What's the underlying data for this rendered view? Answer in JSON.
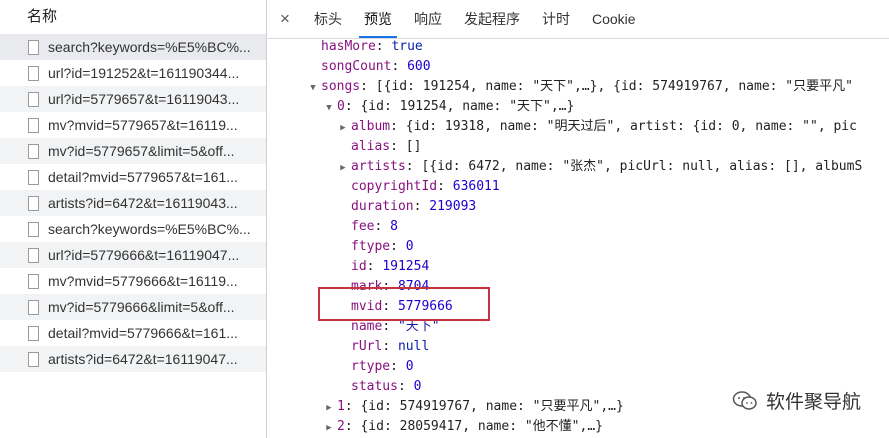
{
  "left_panel": {
    "header": "名称",
    "requests": [
      "search?keywords=%E5%BC%...",
      "url?id=191252&t=161190344...",
      "url?id=5779657&t=16119043...",
      "mv?mvid=5779657&t=16119...",
      "mv?id=5779657&limit=5&off...",
      "detail?mvid=5779657&t=161...",
      "artists?id=6472&t=16119043...",
      "search?keywords=%E5%BC%...",
      "url?id=5779666&t=16119047...",
      "mv?mvid=5779666&t=16119...",
      "mv?id=5779666&limit=5&off...",
      "detail?mvid=5779666&t=161...",
      "artists?id=6472&t=16119047..."
    ]
  },
  "tabs": {
    "close": "×",
    "items": [
      "标头",
      "预览",
      "响应",
      "发起程序",
      "计时",
      "Cookie"
    ],
    "active": "预览"
  },
  "tree": {
    "l1_key": "hasMore",
    "l1_val": "true",
    "l2_key": "songCount",
    "l2_val": "600",
    "l3_key": "songs",
    "l3_val": "[{id: 191254, name: \"天下\",…}, {id: 574919767, name: \"只要平凡\"",
    "l4_key": "0",
    "l4_val": "{id: 191254, name: \"天下\",…}",
    "l5_key": "album",
    "l5_val": "{id: 19318, name: \"明天过后\", artist: {id: 0, name: \"\", pic",
    "l6_key": "alias",
    "l6_val": "[]",
    "l7_key": "artists",
    "l7_val": "[{id: 6472, name: \"张杰\", picUrl: null, alias: [], albumS",
    "l8_key": "copyrightId",
    "l8_val": "636011",
    "l9_key": "duration",
    "l9_val": "219093",
    "l10_key": "fee",
    "l10_val": "8",
    "l11_key": "ftype",
    "l11_val": "0",
    "l12_key": "id",
    "l12_val": "191254",
    "l13_key": "mark",
    "l13_val": "8704",
    "l14_key": "mvid",
    "l14_val": "5779666",
    "l15_key": "name",
    "l15_val": "\"天下\"",
    "l16_key": "rUrl",
    "l16_val": "null",
    "l17_key": "rtype",
    "l17_val": "0",
    "l18_key": "status",
    "l18_val": "0",
    "l19_key": "1",
    "l19_val": "{id: 574919767, name: \"只要平凡\",…}",
    "l20_key": "2",
    "l20_val": "{id: 28059417, name: \"他不懂\",…}"
  },
  "watermark": {
    "text": "软件聚导航",
    "icon": "wechat-official-account-icon"
  },
  "colors": {
    "active_tab_underline": "#1a73e8",
    "highlight_box": "#c8323e",
    "json_key": "#881280"
  }
}
